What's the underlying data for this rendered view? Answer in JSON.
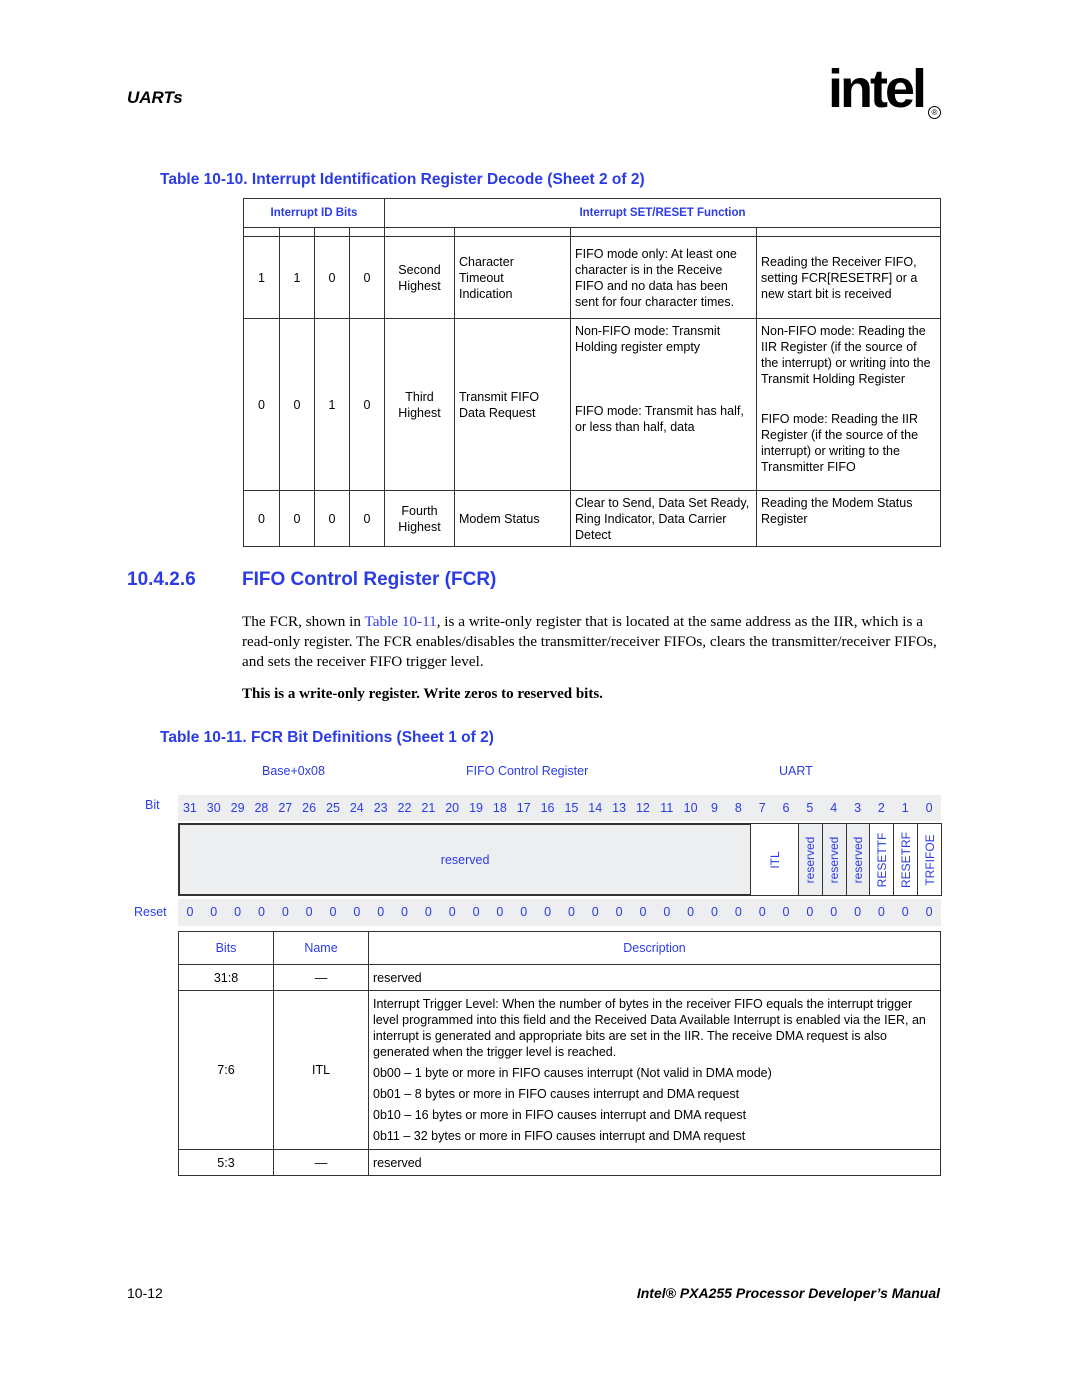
{
  "header": {
    "section": "UARTs",
    "logo_text": "intel",
    "logo_registered": "®"
  },
  "table_10_10": {
    "caption": "Table 10-10. Interrupt Identification Register Decode (Sheet 2 of 2)",
    "headers": [
      "Interrupt ID Bits",
      "Interrupt SET/RESET Function"
    ],
    "rows": [
      {
        "bits": [
          "1",
          "1",
          "0",
          "0"
        ],
        "priority": "Second\nHighest",
        "type": "Character\nTimeout\nIndication",
        "source": "FIFO mode only: At least one character is in the Receive FIFO and no data has been sent for four character times.",
        "reset": "Reading the Receiver FIFO, setting FCR[RESETRF] or a new start bit is received"
      },
      {
        "bits": [
          "0",
          "0",
          "1",
          "0"
        ],
        "priority": "Third\nHighest",
        "type": "Transmit FIFO\nData Request",
        "source_a": "Non-FIFO mode: Transmit Holding register empty",
        "source_b": "FIFO mode: Transmit has half, or less than half, data",
        "reset_a": "Non-FIFO mode: Reading the IIR Register (if the source of the interrupt) or writing into the Transmit Holding Register",
        "reset_b": "FIFO mode: Reading the IIR Register (if the source of the interrupt) or writing to the Transmitter FIFO"
      },
      {
        "bits": [
          "0",
          "0",
          "0",
          "0"
        ],
        "priority": "Fourth\nHighest",
        "type": "Modem Status",
        "source": "Clear to Send, Data Set Ready, Ring Indicator, Data Carrier Detect",
        "reset": "Reading the Modem Status Register"
      }
    ]
  },
  "section": {
    "number": "10.4.2.6",
    "title": "FIFO Control Register (FCR)",
    "para_before": "The FCR, shown in ",
    "para_link": "Table 10-11",
    "para_after": ", is a write-only register that is located at the same address as the IIR, which is a read-only register. The FCR enables/disables the transmitter/receiver FIFOs, clears the transmitter/receiver FIFOs, and sets the receiver FIFO trigger level.",
    "note": "This is a write-only register. Write zeros to reserved bits."
  },
  "register": {
    "caption": "Table 10-11. FCR Bit Definitions (Sheet 1 of 2)",
    "address": "Base+0x08",
    "name": "FIFO Control Register",
    "unit": "UART",
    "bit_label": "Bit",
    "reset_label": "Reset",
    "bits": [
      "31",
      "30",
      "29",
      "28",
      "27",
      "26",
      "25",
      "24",
      "23",
      "22",
      "21",
      "20",
      "19",
      "18",
      "17",
      "16",
      "15",
      "14",
      "13",
      "12",
      "11",
      "10",
      "9",
      "8",
      "7",
      "6",
      "5",
      "4",
      "3",
      "2",
      "1",
      "0"
    ],
    "reset_values": [
      "0",
      "0",
      "0",
      "0",
      "0",
      "0",
      "0",
      "0",
      "0",
      "0",
      "0",
      "0",
      "0",
      "0",
      "0",
      "0",
      "0",
      "0",
      "0",
      "0",
      "0",
      "0",
      "0",
      "0",
      "0",
      "0",
      "0",
      "0",
      "0",
      "0",
      "0",
      "0"
    ],
    "fields": [
      {
        "label": "reserved",
        "span": 24,
        "style": "grey",
        "vertical": false
      },
      {
        "label": "ITL",
        "span": 2,
        "style": "white",
        "vertical": true
      },
      {
        "label": "reserved",
        "span": 1,
        "style": "grey",
        "vertical": true
      },
      {
        "label": "reserved",
        "span": 1,
        "style": "grey",
        "vertical": true
      },
      {
        "label": "reserved",
        "span": 1,
        "style": "grey",
        "vertical": true
      },
      {
        "label": "RESETTF",
        "span": 1,
        "style": "white",
        "vertical": true
      },
      {
        "label": "RESETRF",
        "span": 1,
        "style": "white",
        "vertical": true
      },
      {
        "label": "TRFIFOE",
        "span": 1,
        "style": "white",
        "vertical": true
      }
    ]
  },
  "bit_table": {
    "headers": [
      "Bits",
      "Name",
      "Description"
    ],
    "rows": [
      {
        "bits": "31:8",
        "name": "—",
        "desc": [
          "reserved"
        ]
      },
      {
        "bits": "7:6",
        "name": "ITL",
        "desc": [
          "Interrupt Trigger Level: When the number of bytes in the receiver FIFO equals the interrupt trigger level programmed into this field and the Received Data Available Interrupt is enabled via the IER, an interrupt is generated and appropriate bits are set in the IIR. The receive DMA request is also generated when the trigger level is reached.",
          "0b00 – 1 byte or more in FIFO causes interrupt (Not valid in DMA mode)",
          "0b01 – 8 bytes or more in FIFO causes interrupt and DMA request",
          "0b10 – 16 bytes or more in FIFO causes interrupt and DMA request",
          "0b11 – 32 bytes or more in FIFO causes interrupt and DMA request"
        ]
      },
      {
        "bits": "5:3",
        "name": "—",
        "desc": [
          "reserved"
        ]
      }
    ]
  },
  "footer": {
    "page": "10-12",
    "manual": "Intel® PXA255 Processor Developer’s Manual"
  }
}
